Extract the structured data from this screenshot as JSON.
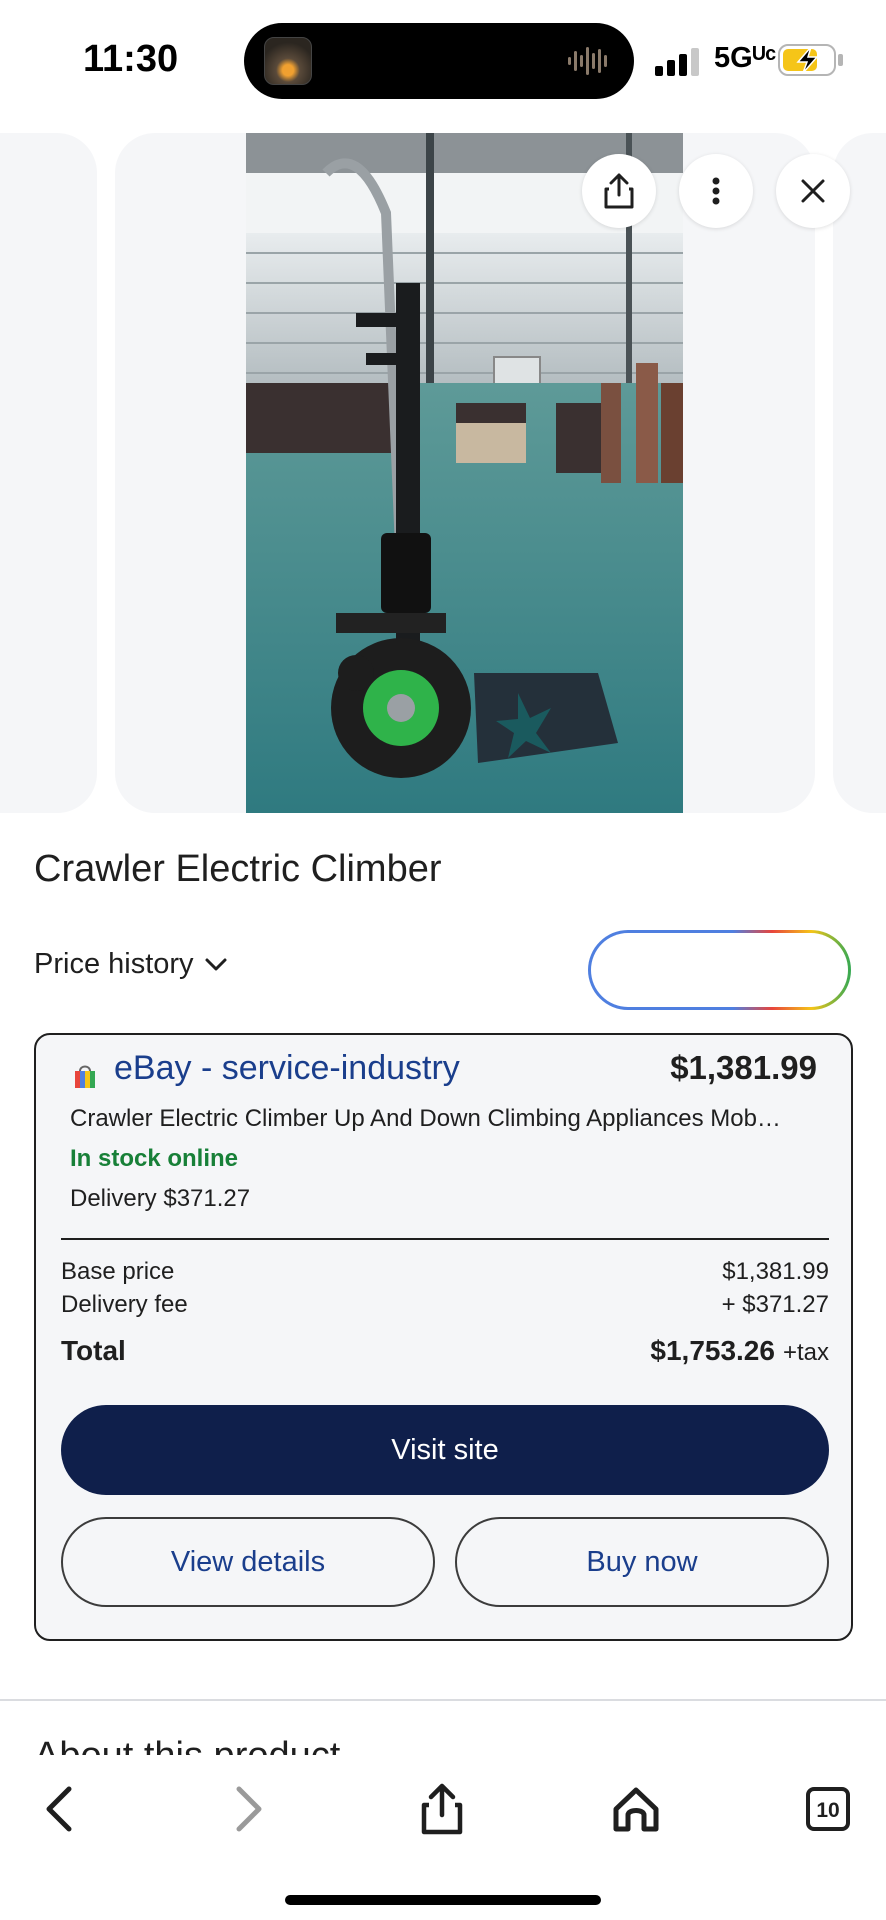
{
  "status_bar": {
    "time": "11:30",
    "network": "5Gᵁᶜ",
    "signal_bars": 3,
    "battery_state": "charging"
  },
  "product": {
    "title": "Crawler Electric Climber"
  },
  "image_controls": {
    "share_icon": "share-icon",
    "more_icon": "more-vert-icon",
    "close_icon": "close-icon"
  },
  "price_history": {
    "label": "Price history"
  },
  "offer": {
    "store": "eBay - service-industry",
    "price": "$1,381.99",
    "description": "Crawler Electric Climber Up And Down Climbing Appliances Mob…",
    "stock": "In stock online",
    "delivery": "Delivery $371.27",
    "breakdown": {
      "base_label": "Base price",
      "base_value": "$1,381.99",
      "delivery_label": "Delivery fee",
      "delivery_value": "+ $371.27",
      "total_label": "Total",
      "total_value": "$1,753.26",
      "tax_note": "+tax"
    },
    "visit_label": "Visit site",
    "details_label": "View details",
    "buy_label": "Buy now"
  },
  "about": {
    "heading": "About this product"
  },
  "toolbar": {
    "tabs_count": "10"
  },
  "colors": {
    "store_link": "#1a3e8c",
    "in_stock": "#188038",
    "visit_button": "#0f1f4b"
  }
}
